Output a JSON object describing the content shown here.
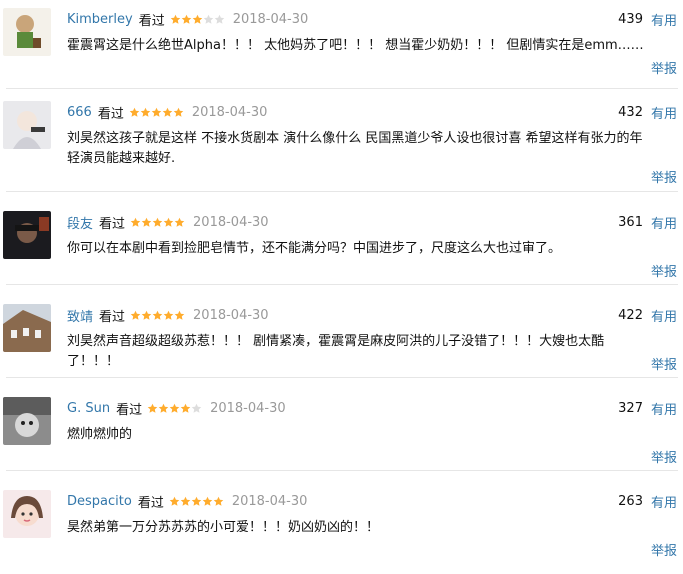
{
  "reviews": [
    {
      "author": "Kimberley",
      "watched": "看过",
      "rating": 3,
      "date": "2018-04-30",
      "votes": "439",
      "useful": "有用",
      "content": "霍震霄这是什么绝世Alpha！！！ 太他妈苏了吧！！！ 想当霍少奶奶！！！ 但剧情实在是emm……",
      "report": "举报"
    },
    {
      "author": "666",
      "watched": "看过",
      "rating": 5,
      "date": "2018-04-30",
      "votes": "432",
      "useful": "有用",
      "content": "刘昊然这孩子就是这样 不接水货剧本 演什么像什么 民国黑道少爷人设也很讨喜 希望这样有张力的年轻演员能越来越好.",
      "report": "举报"
    },
    {
      "author": "段友",
      "watched": "看过",
      "rating": 5,
      "date": "2018-04-30",
      "votes": "361",
      "useful": "有用",
      "content": "你可以在本剧中看到捡肥皂情节，还不能满分吗？中国进步了，尺度这么大也过审了。",
      "report": "举报"
    },
    {
      "author": "致靖",
      "watched": "看过",
      "rating": 5,
      "date": "2018-04-30",
      "votes": "422",
      "useful": "有用",
      "content": "刘昊然声音超级超级苏惹！！！ 剧情紧凑，霍震霄是麻皮阿洪的儿子没错了！！！大嫂也太酷了！！！",
      "report": "举报"
    },
    {
      "author": "G. Sun",
      "watched": "看过",
      "rating": 4,
      "date": "2018-04-30",
      "votes": "327",
      "useful": "有用",
      "content": "燃帅燃帅的",
      "report": "举报"
    },
    {
      "author": "Despacito",
      "watched": "看过",
      "rating": 5,
      "date": "2018-04-30",
      "votes": "263",
      "useful": "有用",
      "content": "昊然弟第一万分苏苏苏的小可爱！！！奶凶奶凶的！！",
      "report": "举报"
    }
  ],
  "colors": {
    "link": "#3377aa",
    "star_on": "#ffac2d",
    "star_off": "#dddddd",
    "date": "#999999"
  }
}
